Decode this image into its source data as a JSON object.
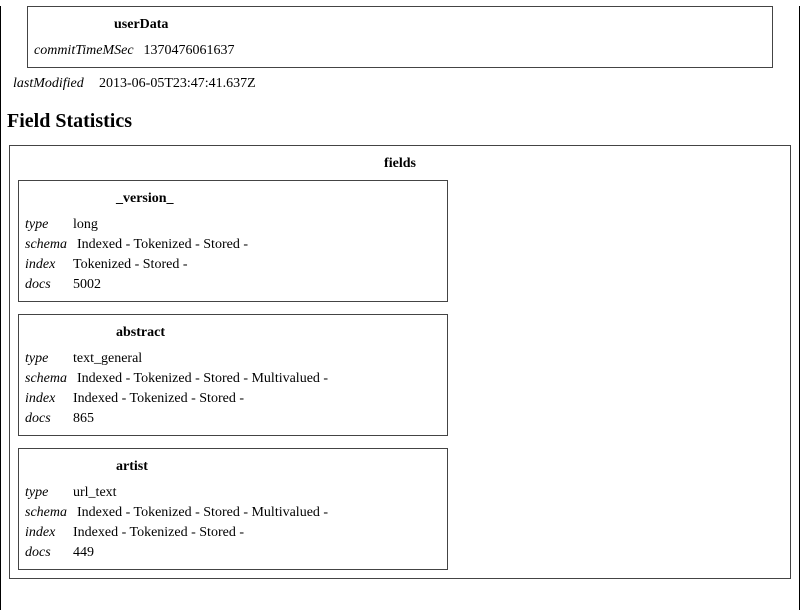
{
  "userData": {
    "title": "userData",
    "commitLabel": "commitTimeMSec",
    "commitValue": "1370476061637"
  },
  "lastModified": {
    "label": "lastModified",
    "value": "2013-06-05T23:47:41.637Z"
  },
  "sectionHeading": "Field Statistics",
  "fieldsTitle": "fields",
  "labels": {
    "type": "type",
    "schema": "schema",
    "index": "index",
    "docs": "docs"
  },
  "fields": [
    {
      "name": "_version_",
      "type": "long",
      "schema": "Indexed - Tokenized - Stored -",
      "index": "Tokenized - Stored -",
      "docs": "5002"
    },
    {
      "name": "abstract",
      "type": "text_general",
      "schema": "Indexed - Tokenized - Stored - Multivalued -",
      "index": "Indexed - Tokenized - Stored -",
      "docs": "865"
    },
    {
      "name": "artist",
      "type": "url_text",
      "schema": "Indexed - Tokenized - Stored - Multivalued -",
      "index": "Indexed - Tokenized - Stored -",
      "docs": "449"
    }
  ]
}
